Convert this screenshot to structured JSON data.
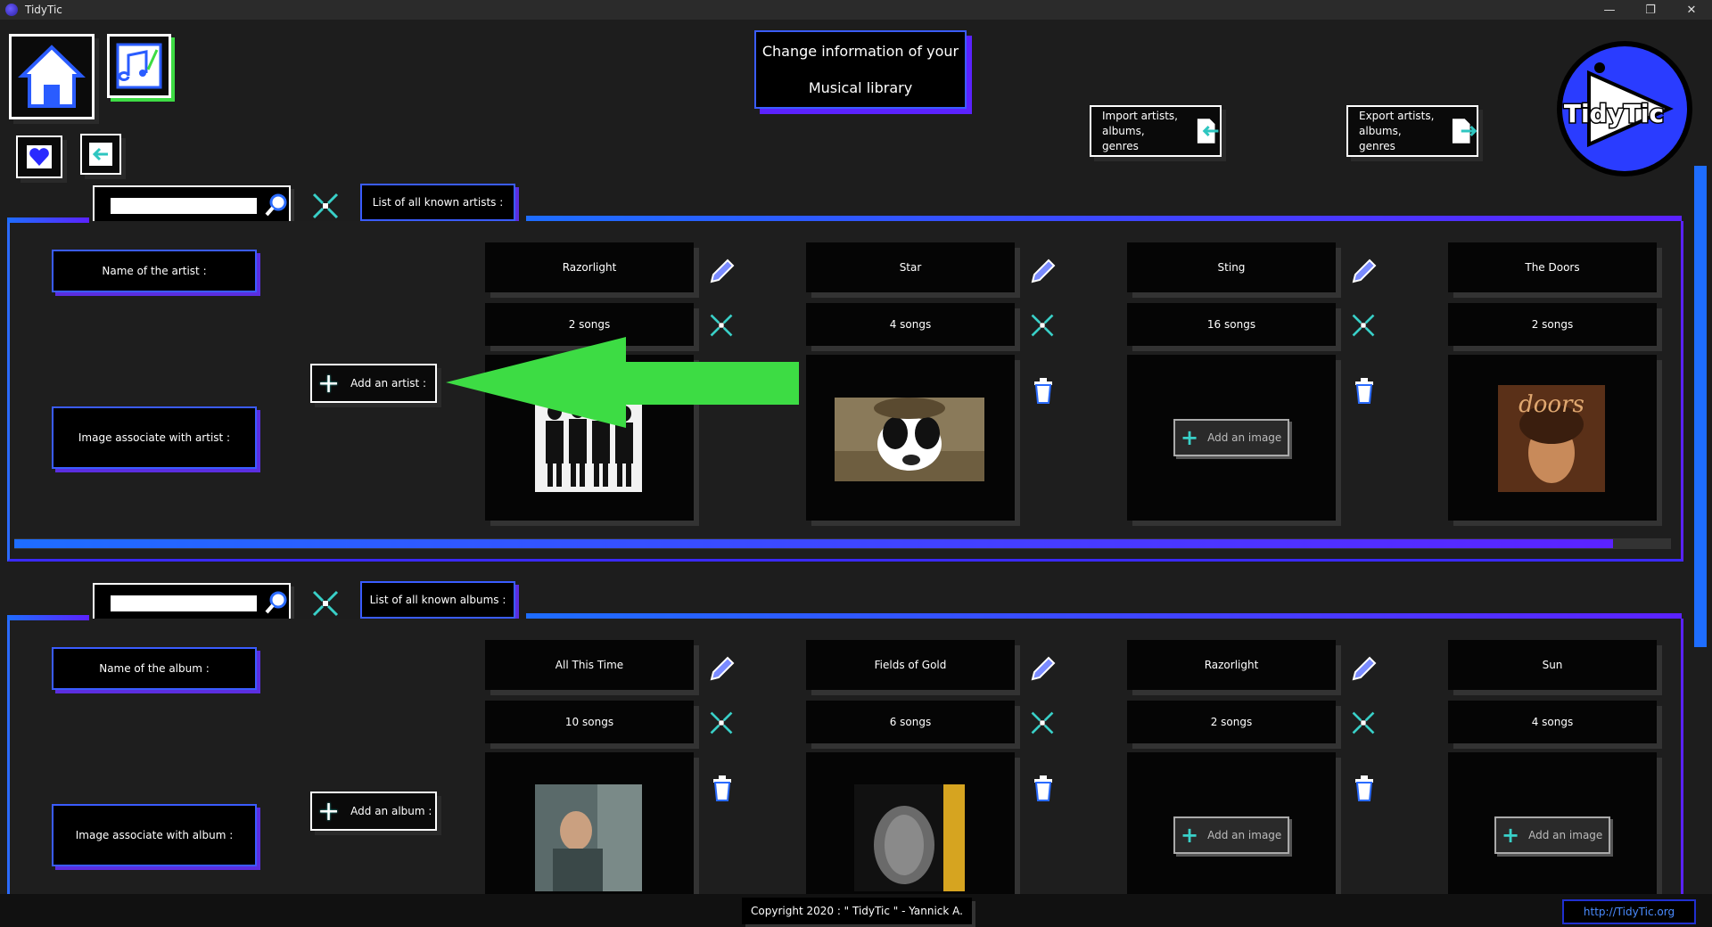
{
  "window": {
    "title": "TidyTic",
    "minimize": "—",
    "maximize": "❐",
    "close": "✕"
  },
  "header": {
    "title_line1": "Change information of your",
    "title_line2": "Musical library",
    "import_label_1": "Import artists,",
    "import_label_2": "albums, genres",
    "export_label_1": "Export artists,",
    "export_label_2": "albums, genres",
    "logo_text": "TidyTic"
  },
  "artists": {
    "tab_label": "List of all known artists :",
    "name_label": "Name of the artist :",
    "image_label": "Image associate with artist :",
    "add_label": "Add an artist :",
    "items": [
      {
        "name": "Razorlight",
        "songs": "2 songs"
      },
      {
        "name": "Star",
        "songs": "4 songs"
      },
      {
        "name": "Sting",
        "songs": "16 songs",
        "add_image": "Add an image"
      },
      {
        "name": "The Doors",
        "songs": "2 songs"
      }
    ],
    "scroll_fraction": 0.965
  },
  "albums": {
    "tab_label": "List of all known albums :",
    "name_label": "Name of the album :",
    "image_label": "Image associate with album :",
    "add_label": "Add an album :",
    "items": [
      {
        "name": "All This Time",
        "songs": "10 songs"
      },
      {
        "name": "Fields of Gold",
        "songs": "6 songs"
      },
      {
        "name": "Razorlight",
        "songs": "2 songs",
        "add_image": "Add an image"
      },
      {
        "name": "Sun",
        "songs": "4 songs",
        "add_image": "Add an image"
      }
    ]
  },
  "footer": {
    "copyright": "Copyright 2020 : \" TidyTic \" - Yannick A.",
    "link": "http://TidyTic.org"
  },
  "colors": {
    "accent_blue": "#1e6dff",
    "accent_purple": "#5b22ff",
    "arrow_green": "#3ddc44"
  }
}
